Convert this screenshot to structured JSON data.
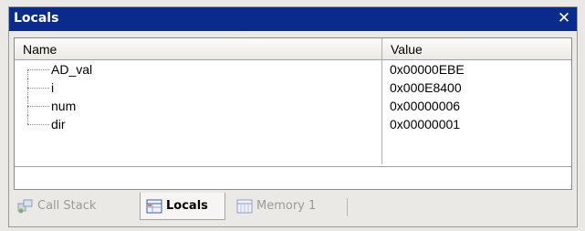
{
  "window": {
    "title": "Locals",
    "close_glyph": "✕"
  },
  "table": {
    "columns": [
      "Name",
      "Value"
    ],
    "rows": [
      {
        "name": "AD_val",
        "value": "0x00000EBE"
      },
      {
        "name": "i",
        "value": "0x000E8400"
      },
      {
        "name": "num",
        "value": "0x00000006"
      },
      {
        "name": "dir",
        "value": "0x00000001"
      }
    ]
  },
  "tabs": [
    {
      "label": "Call Stack",
      "icon": "call-stack-icon",
      "active": false
    },
    {
      "label": "Locals",
      "icon": "locals-icon",
      "active": true
    },
    {
      "label": "Memory 1",
      "icon": "memory-icon",
      "active": false
    }
  ],
  "colors": {
    "titlebar": "#0a2a8c",
    "background": "#ebe9e6",
    "panel": "#ffffff",
    "inactive_tab_text": "#9a9a9a"
  }
}
